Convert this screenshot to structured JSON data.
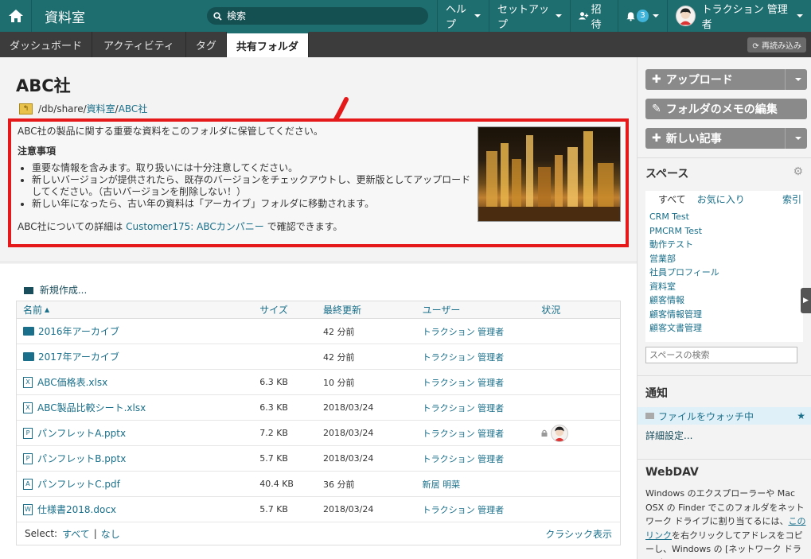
{
  "app": {
    "title": "資料室"
  },
  "topbar": {
    "search_placeholder": "検索",
    "help": "ヘルプ",
    "setup": "セットアップ",
    "invite": "招待",
    "notif_count": "3",
    "user": "トラクション 管理者"
  },
  "tabs": [
    "ダッシュボード",
    "アクティビティ",
    "タグ",
    "共有フォルダ"
  ],
  "reload_label": "再読み込み",
  "page": {
    "title": "ABC社",
    "path": [
      "/db/share/",
      "資料室",
      "/",
      "ABC社"
    ]
  },
  "memo": {
    "intro": "ABC社の製品に関する重要な資料をこのフォルダに保管してください。",
    "heading": "注意事項",
    "bullets": [
      "重要な情報を含みます。取り扱いには十分注意してください。",
      "新しいバージョンが提供されたら、既存のバージョンをチェックアウトし、更新版としてアップロードしてください。（古いバージョンを削除しない！）",
      "新しい年になったら、古い年の資料は「アーカイブ」フォルダに移動されます。"
    ],
    "more_prefix": "ABC社についての詳細は ",
    "more_link": "Customer175: ABCカンパニー",
    "more_suffix": " で確認できます。"
  },
  "files": {
    "new_label": "新規作成...",
    "headers": {
      "name": "名前",
      "size": "サイズ",
      "updated": "最終更新",
      "user": "ユーザー",
      "status": "状況"
    },
    "rows": [
      {
        "type": "folder",
        "name": "2016年アーカイブ",
        "size": "",
        "updated": "42 分前",
        "user": "トラクション 管理者"
      },
      {
        "type": "folder",
        "name": "2017年アーカイブ",
        "size": "",
        "updated": "42 分前",
        "user": "トラクション 管理者"
      },
      {
        "type": "xlsx",
        "name": "ABC価格表.xlsx",
        "size": "6.3 KB",
        "updated": "10 分前",
        "user": "トラクション 管理者"
      },
      {
        "type": "xlsx",
        "name": "ABC製品比較シート.xlsx",
        "size": "6.3 KB",
        "updated": "2018/03/24",
        "user": "トラクション 管理者"
      },
      {
        "type": "pptx",
        "name": "パンフレットA.pptx",
        "size": "7.2 KB",
        "updated": "2018/03/24",
        "user": "トラクション 管理者",
        "locked": true
      },
      {
        "type": "pptx",
        "name": "パンフレットB.pptx",
        "size": "5.7 KB",
        "updated": "2018/03/24",
        "user": "トラクション 管理者"
      },
      {
        "type": "pdf",
        "name": "パンフレットC.pdf",
        "size": "40.4 KB",
        "updated": "36 分前",
        "user": "新居 明菜"
      },
      {
        "type": "docx",
        "name": "仕様書2018.docx",
        "size": "5.7 KB",
        "updated": "2018/03/24",
        "user": "トラクション 管理者"
      }
    ],
    "select_label": "Select:",
    "select_all": "すべて",
    "select_none": "なし",
    "classic": "クラシック表示"
  },
  "sidebar": {
    "upload": "アップロード",
    "edit_memo": "フォルダのメモの編集",
    "new_article": "新しい記事",
    "spaces_title": "スペース",
    "spaces_tabs": [
      "すべて",
      "お気に入り"
    ],
    "index": "索引",
    "spaces": [
      "CRM Test",
      "PMCRM Test",
      "動作テスト",
      "営業部",
      "社員プロフィール",
      "資料室",
      "顧客情報",
      "顧客情報管理",
      "顧客文書管理"
    ],
    "space_search_placeholder": "スペースの検索",
    "notify_title": "通知",
    "watching": "ファイルをウォッチ中",
    "detail": "詳細設定...",
    "webdav_title": "WebDAV",
    "webdav_text_1": "Windows のエクスプローラーや Mac OSX の Finder でこのフォルダをネットワーク ドライブに割り当てるには、",
    "webdav_link": "このリンク",
    "webdav_text_2": "を右クリックしてアドレスをコピーし、Windows の [ネットワーク ドライブ"
  }
}
